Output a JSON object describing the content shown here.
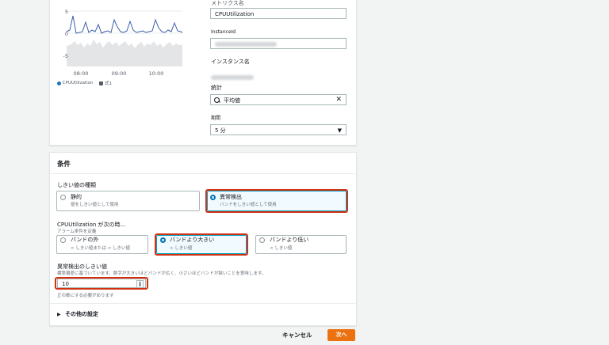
{
  "chart": {
    "y_ticks": [
      "5",
      "0",
      "-5"
    ],
    "x_ticks": [
      "08:00",
      "09:00",
      "10:00"
    ],
    "legend": [
      {
        "name": "CPUUtilization",
        "color": "#1f77b4"
      },
      {
        "name": "式1",
        "color": "#545b64"
      }
    ],
    "series_color": "#3b5fa8"
  },
  "metric_form": {
    "metric_name_label": "メトリクス名",
    "metric_name_value": "CPUUtilization",
    "instance_id_label": "InstanceId",
    "instance_name_label": "インスタンス名",
    "statistic_label": "統計",
    "statistic_value": "平均値",
    "period_label": "期間",
    "period_value": "5 分"
  },
  "conditions": {
    "title": "条件",
    "threshold_type_label": "しきい値の種類",
    "threshold_types": [
      {
        "title": "静的",
        "desc": "値をしきい値として使用",
        "selected": false
      },
      {
        "title": "異常検出",
        "desc": "バンドをしきい値として使用",
        "selected": true
      }
    ],
    "when_label": "CPUUtilization が次の時...",
    "when_sub": "アラーム条件を定義",
    "options": [
      {
        "title": "バンドの外",
        "desc": "> しきい値または < しきい値",
        "selected": false
      },
      {
        "title": "バンドより大きい",
        "desc": "> しきい値",
        "selected": true
      },
      {
        "title": "バンドより低い",
        "desc": "< しきい値",
        "selected": false
      }
    ],
    "anomaly_label": "異常検出のしきい値",
    "anomaly_desc": "標準偏差に基づいています。数字が大きいほどバンドが広く、小さいほどバンドが狭いことを意味します。",
    "anomaly_value": "10",
    "anomaly_hint": "正の数にする必要があります",
    "other_settings": "その他の設定"
  },
  "footer": {
    "cancel_label": "キャンセル",
    "next_label": "次へ",
    "accent": "#ec7211"
  }
}
